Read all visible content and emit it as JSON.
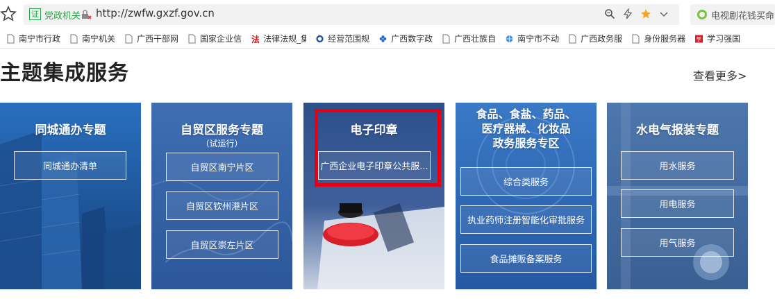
{
  "browser": {
    "gov_label": "党政机关",
    "url": "http://zwfw.gxzf.gov.cn",
    "search_text": "电视剧花钱买命",
    "cert_glyph": "证",
    "star_color": "#f5a623",
    "bookmarks": [
      {
        "label": "南宁市行政",
        "icon": "page-icon"
      },
      {
        "label": "南宁机关",
        "icon": "page-icon"
      },
      {
        "label": "广西干部网",
        "icon": "page-icon"
      },
      {
        "label": "国家企业信",
        "icon": "page-icon"
      },
      {
        "label": "法律法规_集",
        "icon": "law-icon"
      },
      {
        "label": "经营范围规",
        "icon": "circle-logo-icon"
      },
      {
        "label": "广西数字政",
        "icon": "flower-icon"
      },
      {
        "label": "广西壮族自",
        "icon": "page-icon"
      },
      {
        "label": "南宁市不动",
        "icon": "globe-icon"
      },
      {
        "label": "广西政务服",
        "icon": "page-icon"
      },
      {
        "label": "身份服务器",
        "icon": "page-icon"
      },
      {
        "label": "学习强国",
        "icon": "xuexi-icon"
      }
    ]
  },
  "section": {
    "title": "主题集成服务",
    "more": "查看更多>"
  },
  "cards": [
    {
      "title": "同城通办专题",
      "buttons": [
        "同城通办清单"
      ]
    },
    {
      "title": "自贸区服务专题",
      "subtitle": "（试运行）",
      "buttons": [
        "自贸区南宁片区",
        "自贸区钦州港片区",
        "自贸区崇左片区"
      ]
    },
    {
      "title": "电子印章",
      "buttons": [
        "广西企业电子印章公共服..."
      ]
    },
    {
      "title_lines": [
        "食品、食盐、药品、",
        "医疗器械、化妆品",
        "政务服务专区"
      ],
      "buttons": [
        "综合类服务",
        "执业药师注册智能化审批服务",
        "食品摊贩备案服务"
      ]
    },
    {
      "title": "水电气报装专题",
      "buttons": [
        "用水服务",
        "用电服务",
        "用气服务"
      ]
    }
  ],
  "colors": {
    "highlight": "#e60012",
    "gov_green": "#22a745"
  }
}
